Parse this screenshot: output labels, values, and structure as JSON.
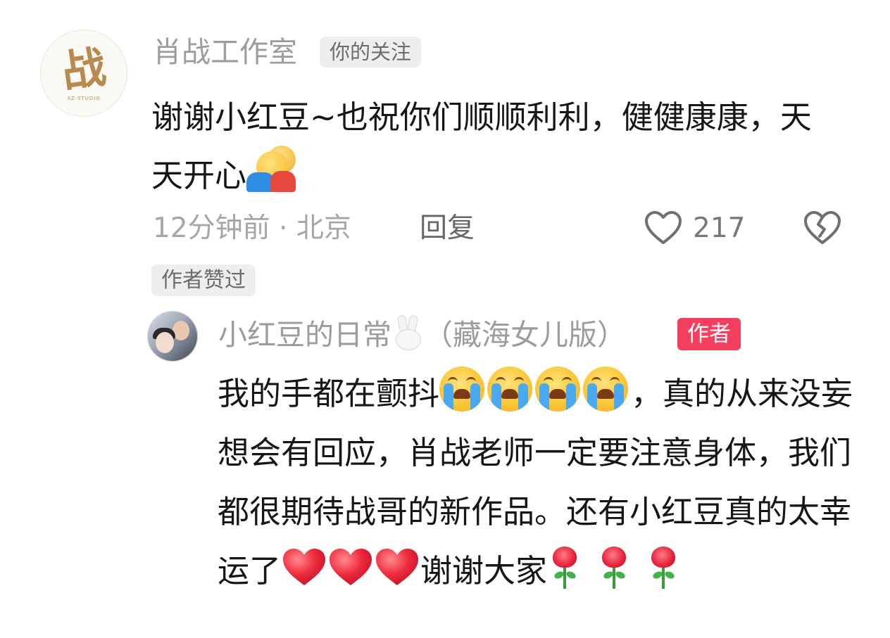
{
  "comment": {
    "avatar_glyph": "战",
    "avatar_subtext": "XZ·STUDIO",
    "author": "肖战工作室",
    "follow_badge": "你的关注",
    "text_part1": "谢谢小红豆~也祝你们顺顺利利，健健康康，天天开心",
    "time": "12分钟前",
    "separator": " · ",
    "location": "北京",
    "reply_label": "回复",
    "like_count": "217",
    "author_liked_badge": "作者赞过"
  },
  "reply": {
    "author": "小红豆的日常",
    "author_suffix": "（藏海女儿版）",
    "author_badge": "作者",
    "text_part1": "我的手都在颤抖",
    "text_part2": "，真的从来没妄想会有回应，肖战老师一定要注意身体，我们都很期待战哥的新作品。还有小红豆真的太幸运了",
    "text_part3": "谢谢大家"
  },
  "colors": {
    "secondary_text": "#9c9c9c",
    "badge_bg": "#eeeeee",
    "author_badge_bg": "#f43f5e",
    "heart_red": "#e8253d"
  },
  "icons": {
    "like": "heart-outline-icon",
    "dislike": "broken-heart-outline-icon"
  }
}
